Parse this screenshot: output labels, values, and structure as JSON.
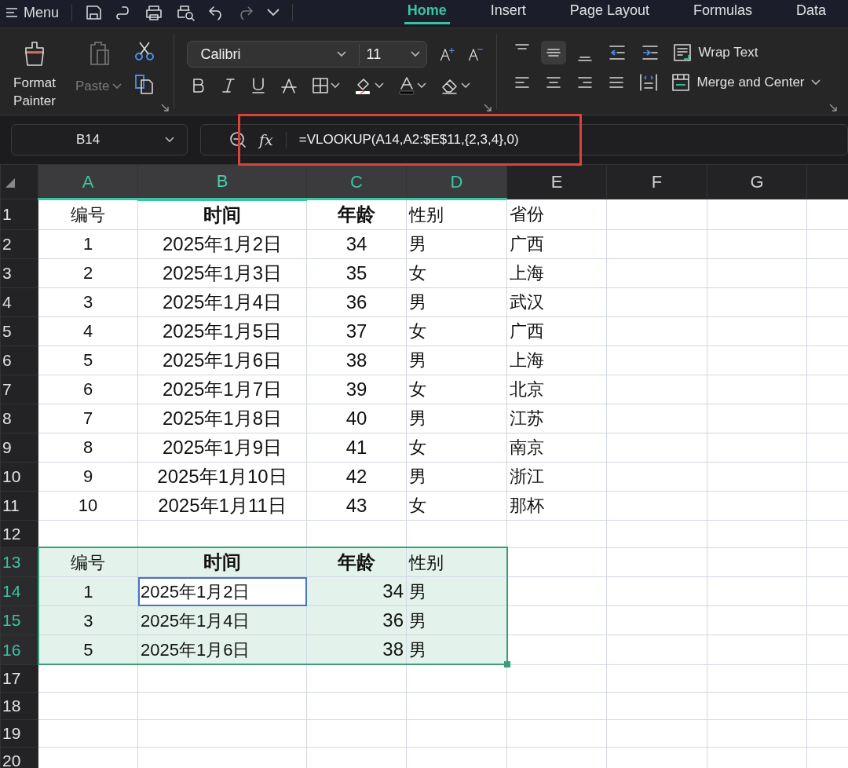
{
  "menu": {
    "label": "Menu"
  },
  "tabs": [
    {
      "label": "Home",
      "selected": true
    },
    {
      "label": "Insert",
      "selected": false
    },
    {
      "label": "Page Layout",
      "selected": false
    },
    {
      "label": "Formulas",
      "selected": false
    },
    {
      "label": "Data",
      "selected": false
    }
  ],
  "ribbon": {
    "format_painter": "Format Painter",
    "paste": {
      "label": "Paste",
      "disabled": true
    },
    "font": "Calibri",
    "font_size": "11",
    "vertical_align": [
      {
        "selected": false
      },
      {
        "selected": true
      },
      {
        "selected": false
      }
    ],
    "wrap_text": "Wrap Text",
    "merge": "Merge and Center"
  },
  "formula_bar": {
    "name_box": "B14",
    "function_label": "fx",
    "formula": "=VLOOKUP(A14,A2:$E$11,{2,3,4},0)",
    "highlighted": true
  },
  "columns": [
    {
      "label": "A",
      "selected": true,
      "active": false
    },
    {
      "label": "B",
      "selected": true,
      "active": true
    },
    {
      "label": "C",
      "selected": true,
      "active": false
    },
    {
      "label": "D",
      "selected": true,
      "active": false
    },
    {
      "label": "E",
      "selected": false,
      "active": false
    },
    {
      "label": "F",
      "selected": false,
      "active": false
    },
    {
      "label": "G",
      "selected": false,
      "active": false
    }
  ],
  "rows": [
    {
      "number": "1",
      "kind": "header",
      "selected": false,
      "active": false,
      "cells": [
        "编号",
        "时间",
        "年龄",
        "性别",
        "省份"
      ]
    },
    {
      "number": "2",
      "kind": "data",
      "selected": false,
      "active": false,
      "cells": [
        "1",
        "2025年1月2日",
        "34",
        "男",
        "广西"
      ]
    },
    {
      "number": "3",
      "kind": "data",
      "selected": false,
      "active": false,
      "cells": [
        "2",
        "2025年1月3日",
        "35",
        "女",
        "上海"
      ]
    },
    {
      "number": "4",
      "kind": "data",
      "selected": false,
      "active": false,
      "cells": [
        "3",
        "2025年1月4日",
        "36",
        "男",
        "武汉"
      ]
    },
    {
      "number": "5",
      "kind": "data",
      "selected": false,
      "active": false,
      "cells": [
        "4",
        "2025年1月5日",
        "37",
        "女",
        "广西"
      ]
    },
    {
      "number": "6",
      "kind": "data",
      "selected": false,
      "active": false,
      "cells": [
        "5",
        "2025年1月6日",
        "38",
        "男",
        "上海"
      ]
    },
    {
      "number": "7",
      "kind": "data",
      "selected": false,
      "active": false,
      "cells": [
        "6",
        "2025年1月7日",
        "39",
        "女",
        "北京"
      ]
    },
    {
      "number": "8",
      "kind": "data",
      "selected": false,
      "active": false,
      "cells": [
        "7",
        "2025年1月8日",
        "40",
        "男",
        "江苏"
      ]
    },
    {
      "number": "9",
      "kind": "data",
      "selected": false,
      "active": false,
      "cells": [
        "8",
        "2025年1月9日",
        "41",
        "女",
        "南京"
      ]
    },
    {
      "number": "10",
      "kind": "data",
      "selected": false,
      "active": false,
      "cells": [
        "9",
        "2025年1月10日",
        "42",
        "男",
        "浙江"
      ]
    },
    {
      "number": "11",
      "kind": "data",
      "selected": false,
      "active": false,
      "cells": [
        "10",
        "2025年1月11日",
        "43",
        "女",
        "那杯"
      ]
    },
    {
      "number": "12",
      "kind": "empty",
      "selected": false,
      "active": false
    },
    {
      "number": "13",
      "kind": "header",
      "selected": true,
      "active": false,
      "cells": [
        "编号",
        "时间",
        "年龄",
        "性别"
      ]
    },
    {
      "number": "14",
      "kind": "data",
      "selected": true,
      "active": true,
      "cells": [
        "1",
        "2025年1月2日",
        "34",
        "男"
      ]
    },
    {
      "number": "15",
      "kind": "data",
      "selected": true,
      "active": false,
      "cells": [
        "3",
        "2025年1月4日",
        "36",
        "男"
      ]
    },
    {
      "number": "16",
      "kind": "data",
      "selected": true,
      "active": false,
      "cells": [
        "5",
        "2025年1月6日",
        "38",
        "男"
      ]
    },
    {
      "number": "17",
      "kind": "empty",
      "selected": false,
      "active": false
    },
    {
      "number": "18",
      "kind": "empty",
      "selected": false,
      "active": false
    },
    {
      "number": "19",
      "kind": "empty",
      "selected": false,
      "active": false
    },
    {
      "number": "20",
      "kind": "empty",
      "selected": false,
      "active": false
    }
  ]
}
